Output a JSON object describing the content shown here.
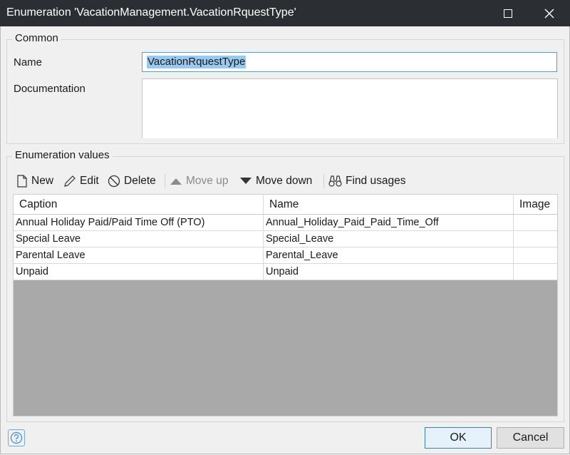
{
  "window": {
    "title": "Enumeration 'VacationManagement.VacationRquestType'"
  },
  "common": {
    "group_label": "Common",
    "name_label": "Name",
    "name_value": "VacationRquestType",
    "documentation_label": "Documentation",
    "documentation_value": ""
  },
  "enum_values": {
    "group_label": "Enumeration values",
    "toolbar": {
      "new": "New",
      "edit": "Edit",
      "delete": "Delete",
      "move_up": "Move up",
      "move_down": "Move down",
      "find_usages": "Find usages"
    },
    "columns": [
      "Caption",
      "Name",
      "Image"
    ],
    "rows": [
      {
        "caption": "Annual Holiday Paid/Paid Time Off (PTO)",
        "name": "Annual_Holiday_Paid_Paid_Time_Off",
        "image": ""
      },
      {
        "caption": "Special Leave",
        "name": "Special_Leave",
        "image": ""
      },
      {
        "caption": "Parental Leave",
        "name": "Parental_Leave",
        "image": ""
      },
      {
        "caption": "Unpaid",
        "name": "Unpaid",
        "image": ""
      }
    ]
  },
  "footer": {
    "ok": "OK",
    "cancel": "Cancel",
    "help_icon": "question-icon"
  },
  "colors": {
    "titlebar": "#2b2f33",
    "selection": "#99c9ef",
    "focus_border": "#4aa2dd",
    "grid_empty": "#a9a9a9"
  }
}
